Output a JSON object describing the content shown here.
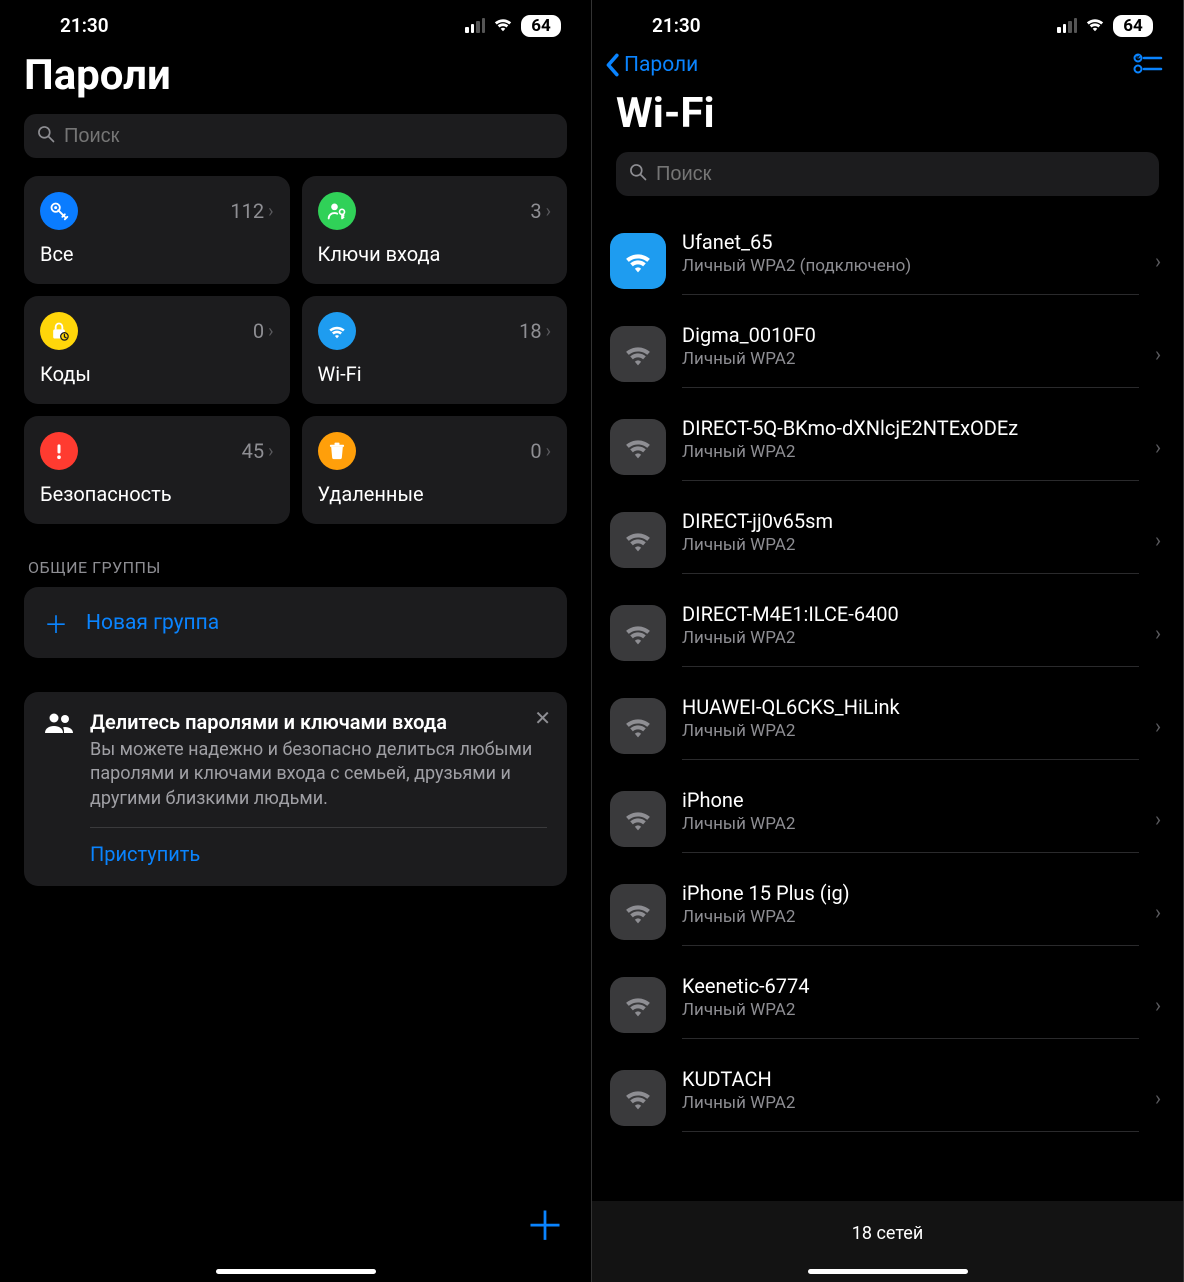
{
  "status": {
    "time": "21:30",
    "battery": "64"
  },
  "left": {
    "title": "Пароли",
    "search_placeholder": "Поиск",
    "cards": [
      {
        "label": "Все",
        "count": "112",
        "color": "#0a7cff",
        "icon": "key"
      },
      {
        "label": "Ключи входа",
        "count": "3",
        "color": "#30d158",
        "icon": "passkey"
      },
      {
        "label": "Коды",
        "count": "0",
        "color": "#ffd60a",
        "icon": "lock"
      },
      {
        "label": "Wi-Fi",
        "count": "18",
        "color": "#1e9cf0",
        "icon": "wifi"
      },
      {
        "label": "Безопасность",
        "count": "45",
        "color": "#ff3b30",
        "icon": "alert"
      },
      {
        "label": "Удаленные",
        "count": "0",
        "color": "#ff9f0a",
        "icon": "trash"
      }
    ],
    "groups_header": "ОБЩИЕ ГРУППЫ",
    "new_group_label": "Новая группа",
    "tip": {
      "title": "Делитесь паролями и ключами входа",
      "body": "Вы можете надежно и безопасно делиться любыми паролями и ключами входа с семьей, друзьями и другими близкими людьми.",
      "cta": "Приступить"
    }
  },
  "right": {
    "back_label": "Пароли",
    "title": "Wi-Fi",
    "search_placeholder": "Поиск",
    "networks": [
      {
        "name": "Ufanet_65",
        "sub": "Личный WPA2 (подключено)",
        "connected": true
      },
      {
        "name": "Digma_0010F0",
        "sub": "Личный WPA2",
        "connected": false
      },
      {
        "name": "DIRECT-5Q-BKmo-dXNlcjE2NTExODEz",
        "sub": "Личный WPA2",
        "connected": false
      },
      {
        "name": "DIRECT-jj0v65sm",
        "sub": "Личный WPA2",
        "connected": false
      },
      {
        "name": "DIRECT-M4E1:ILCE-6400",
        "sub": "Личный WPA2",
        "connected": false
      },
      {
        "name": "HUAWEI-QL6CKS_HiLink",
        "sub": "Личный WPA2",
        "connected": false
      },
      {
        "name": "iPhone",
        "sub": "Личный WPA2",
        "connected": false
      },
      {
        "name": "iPhone 15 Plus (ig)",
        "sub": "Личный WPA2",
        "connected": false
      },
      {
        "name": "Keenetic-6774",
        "sub": "Личный WPA2",
        "connected": false
      },
      {
        "name": "KUDTACH",
        "sub": "Личный WPA2",
        "connected": false
      }
    ],
    "footer": "18 сетей"
  }
}
